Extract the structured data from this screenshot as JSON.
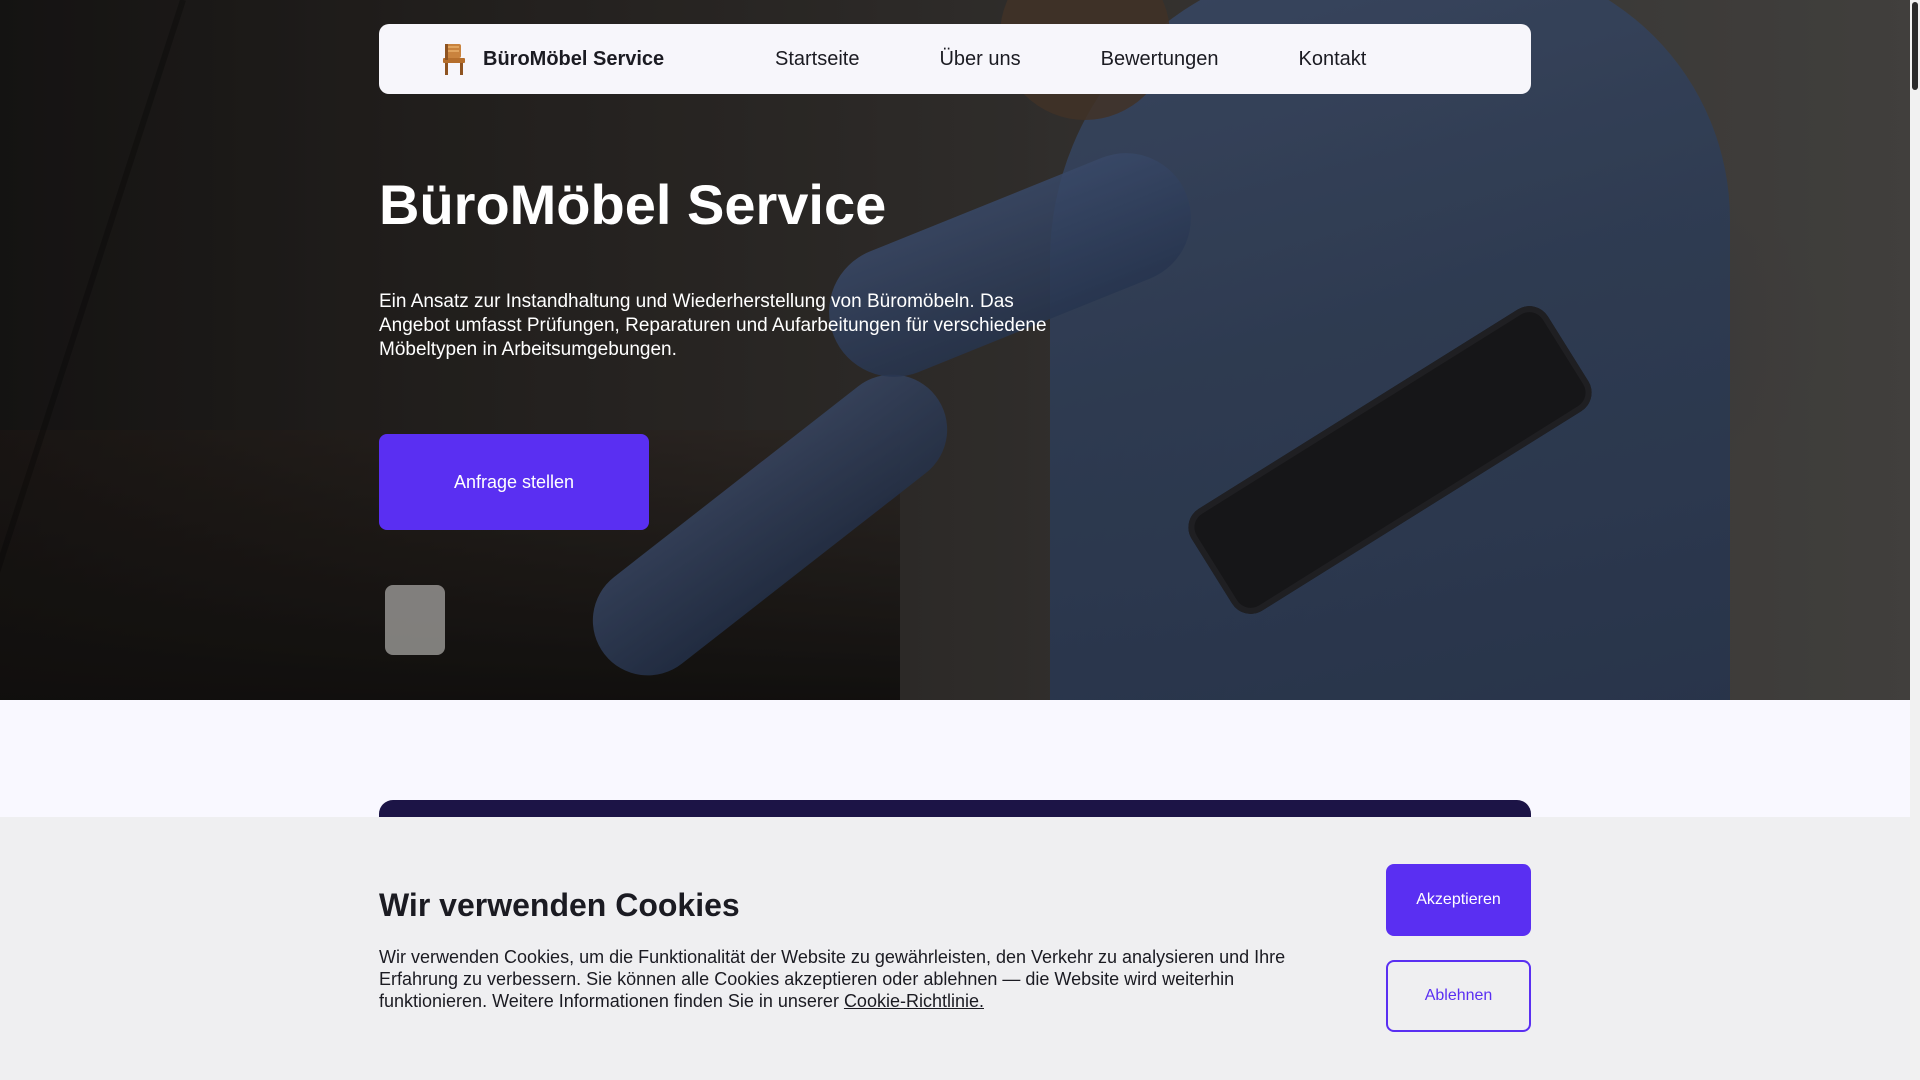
{
  "nav": {
    "brand": "BüroMöbel Service",
    "brand_icon": "chair-icon",
    "links": [
      "Startseite",
      "Über uns",
      "Bewertungen",
      "Kontakt"
    ]
  },
  "hero": {
    "title": "BüroMöbel Service",
    "description": "Ein Ansatz zur Instandhaltung und Wiederherstellung von Büromöbeln. Das Angebot umfasst Prüfungen, Reparaturen und Aufarbeitungen für verschiedene Möbeltypen in Arbeitsumgebungen.",
    "cta_label": "Anfrage stellen"
  },
  "cookie_banner": {
    "title": "Wir verwenden Cookies",
    "text": "Wir verwenden Cookies, um die Funktionalität der Website zu gewährleisten, den Verkehr zu analysieren und Ihre Erfahrung zu verbessern. Sie können alle Cookies akzeptieren oder ablehnen — die Website wird weiterhin funktionieren. Weitere Informationen finden Sie in unserer ",
    "policy_link": "Cookie-Richtlinie.",
    "accept_label": "Akzeptieren",
    "decline_label": "Ablehnen"
  },
  "colors": {
    "accent": "#5a2ff2",
    "dark_card": "#1c1446",
    "nav_bg": "#f7f6fb",
    "cookie_bg": "#efeff1"
  }
}
